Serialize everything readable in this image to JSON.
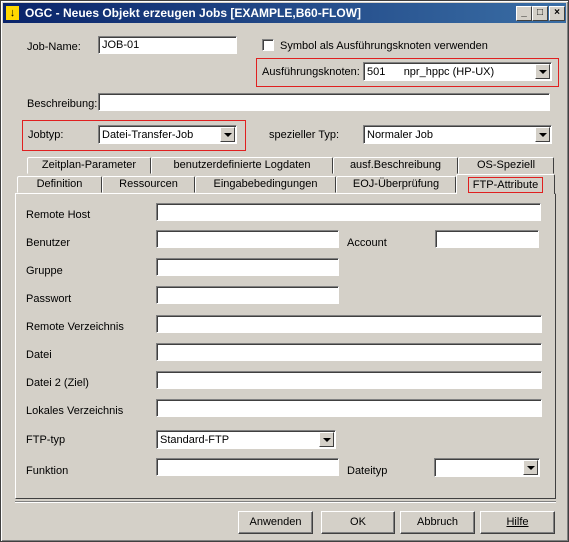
{
  "window": {
    "title": "OGC - Neues Objekt erzeugen Jobs [EXAMPLE,B60-FLOW]",
    "icon": "app-icon",
    "controls": [
      "_",
      "□",
      "×"
    ]
  },
  "job_name": {
    "label": "Job-Name:",
    "value": "JOB-01"
  },
  "symbol_checkbox": {
    "label": "Symbol als Ausführungsknoten verwenden",
    "checked": false
  },
  "exec_node": {
    "label": "Ausführungsknoten:",
    "value": "501      npr_hppc (HP-UX)"
  },
  "description": {
    "label": "Beschreibung:",
    "value": ""
  },
  "job_type": {
    "label": "Jobtyp:",
    "value": "Datei-Transfer-Job"
  },
  "special_type": {
    "label": "spezieller Typ:",
    "value": "Normaler Job"
  },
  "tabs_row1": [
    {
      "label": "Zeitplan-Parameter"
    },
    {
      "label": "benutzerdefinierte Logdaten"
    },
    {
      "label": "ausf.Beschreibung"
    },
    {
      "label": "OS-Speziell"
    }
  ],
  "tabs_row2": [
    {
      "label": "Definition"
    },
    {
      "label": "Ressourcen"
    },
    {
      "label": "Eingabebedingungen"
    },
    {
      "label": "EOJ-Überprüfung"
    },
    {
      "label": "FTP-Attribute"
    }
  ],
  "ftp": {
    "remote_host": {
      "label": "Remote Host",
      "value": ""
    },
    "user": {
      "label": "Benutzer",
      "value": ""
    },
    "account": {
      "label": "Account",
      "value": ""
    },
    "group": {
      "label": "Gruppe",
      "value": ""
    },
    "password": {
      "label": "Passwort",
      "value": ""
    },
    "remote_dir": {
      "label": "Remote Verzeichnis",
      "value": ""
    },
    "file": {
      "label": "Datei",
      "value": ""
    },
    "file2": {
      "label": "Datei 2 (Ziel)",
      "value": ""
    },
    "local_dir": {
      "label": "Lokales Verzeichnis",
      "value": ""
    },
    "ftp_type": {
      "label": "FTP-typ",
      "value": "Standard-FTP"
    },
    "function": {
      "label": "Funktion",
      "value": ""
    },
    "file_type": {
      "label": "Dateityp",
      "value": ""
    }
  },
  "buttons": {
    "apply": "Anwenden",
    "ok": "OK",
    "cancel": "Abbruch",
    "help": "Hilfe"
  },
  "colors": {
    "title_bar": "#0a246a",
    "highlight_box": "#e02020",
    "dialog_bg": "#d4d0c8"
  }
}
